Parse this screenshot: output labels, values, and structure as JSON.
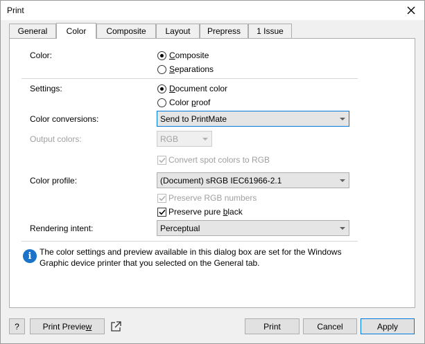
{
  "window": {
    "title": "Print"
  },
  "tabs": [
    "General",
    "Color",
    "Composite",
    "Layout",
    "Prepress",
    "1 Issue"
  ],
  "color_section": {
    "label": "Color:",
    "options": [
      {
        "pre": "",
        "key": "C",
        "post": "omposite",
        "checked": true
      },
      {
        "pre": "",
        "key": "S",
        "post": "eparations",
        "checked": false
      }
    ]
  },
  "settings_section": {
    "label": "Settings:",
    "options": [
      {
        "pre": "",
        "key": "D",
        "post": "ocument color",
        "checked": true
      },
      {
        "pre": "Color ",
        "key": "p",
        "post": "roof",
        "checked": false
      }
    ]
  },
  "color_conversions": {
    "label": "Color conversions:",
    "value": "Send to PrintMate"
  },
  "output_colors": {
    "label": "Output colors:",
    "value": "RGB"
  },
  "convert_spot": {
    "label": "Convert spot colors to RGB",
    "checked": true
  },
  "color_profile": {
    "label": "Color profile:",
    "value": "(Document) sRGB IEC61966-2.1"
  },
  "preserve_rgb": {
    "label": "Preserve RGB numbers",
    "checked": true
  },
  "preserve_black": {
    "pre": "Preserve pure ",
    "key": "b",
    "post": "lack",
    "checked": true
  },
  "rendering_intent": {
    "label": "Rendering intent:",
    "value": "Perceptual"
  },
  "info": {
    "text": "The color settings and preview available in this dialog box are set for the Windows Graphic device printer that you selected on the General tab."
  },
  "buttons": {
    "help": "?",
    "preview_pre": "Print Previe",
    "preview_key": "w",
    "print": "Print",
    "cancel": "Cancel",
    "apply": "Apply"
  }
}
